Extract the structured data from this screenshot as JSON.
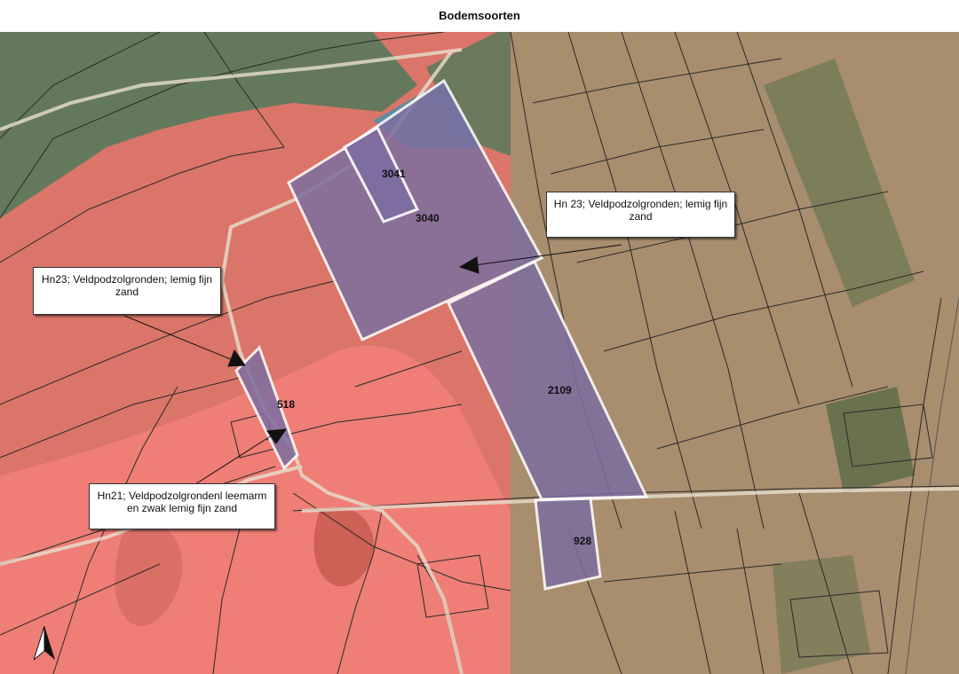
{
  "title": "Bodemsoorten",
  "parcels": [
    "3041",
    "3040",
    "2109",
    "518",
    "928"
  ],
  "callouts": [
    "Hn 23; Veldpodzolgronden; lemig fijn zand",
    "Hn23; Veldpodzolgronden; lemig fijn zand",
    "Hn21; Veldpodzolgrondenl leemarm en zwak lemig fijn zand"
  ],
  "colors": {
    "soil_hn23": "#e8766c",
    "soil_hn21": "#f08a80",
    "soil_green": "#4f7a5a",
    "soil_blue": "#4c8fa8",
    "parcel_fill": "#7d6ea0",
    "parcel_outline": "#ffffff"
  },
  "north_arrow_icon": "north-arrow-icon"
}
